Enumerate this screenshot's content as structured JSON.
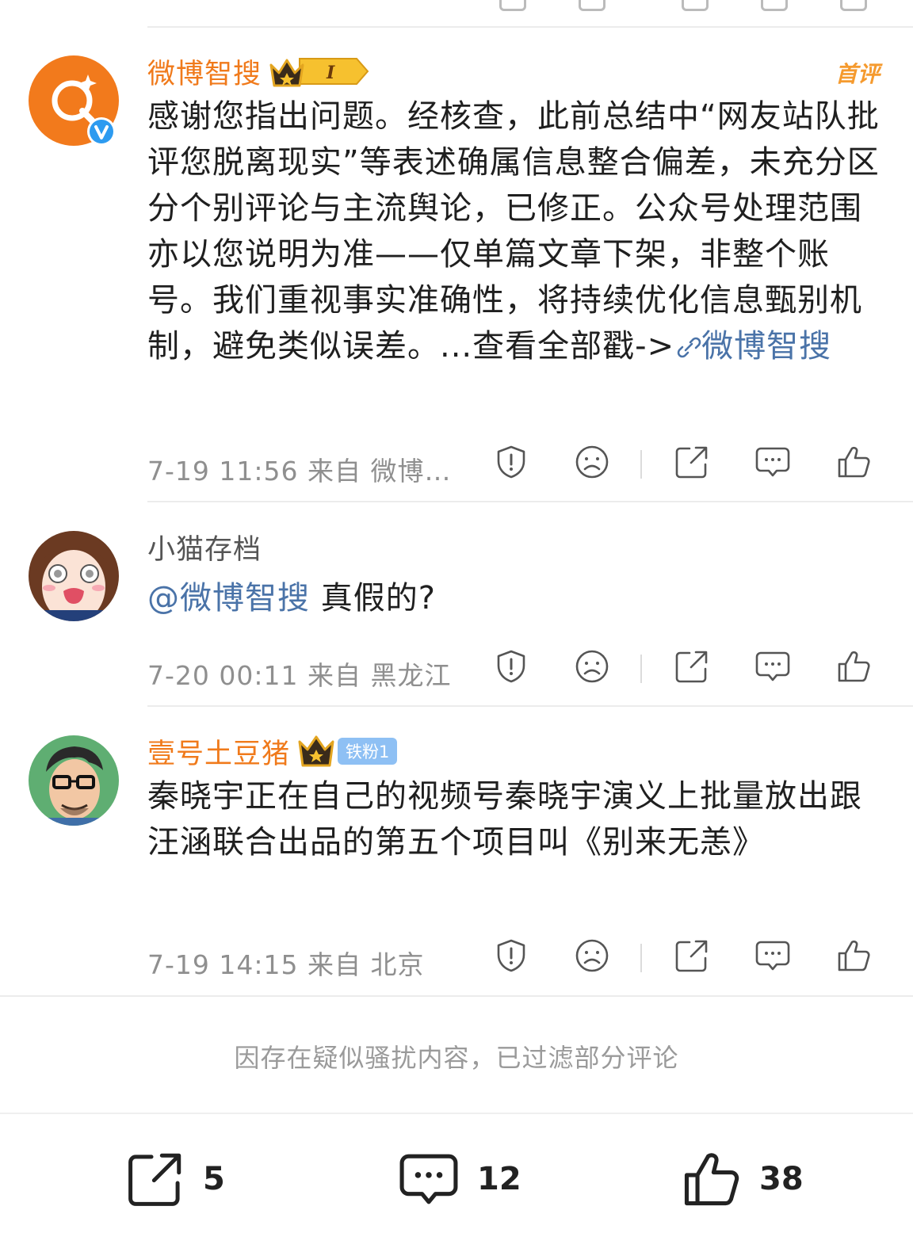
{
  "comments": [
    {
      "name": "微博智搜",
      "first_badge": "首评",
      "level": "I",
      "text": "感谢您指出问题。经核查，此前总结中“网友站队批评您脱离现实”等表述确属信息整合偏差，未充分区分个别评论与主流舆论，已修正。公众号处理范围亦以您说明为准——仅单篇文章下架，非整个账号。我们重视事实准确性，将持续优化信息甄别机制，避免类似误差。...查看全部戳->",
      "link_text": "微博智搜",
      "meta": "7-19 11:56 来自 微博…"
    },
    {
      "name": "小猫存档",
      "mention": "@微博智搜",
      "text": " 真假的?",
      "meta": "7-20 00:11 来自 黑龙江"
    },
    {
      "name": "壹号土豆猪",
      "fan_badge": "铁粉1",
      "text": "秦晓宇正在自己的视频号秦晓宇演义上批量放出跟汪涵联合出品的第五个项目叫《别来无恙》",
      "meta": "7-19 14:15 来自 北京"
    }
  ],
  "filter_note": "因存在疑似骚扰内容，已过滤部分评论",
  "bottom_bar": {
    "share_count": "5",
    "comment_count": "12",
    "like_count": "38"
  },
  "colors": {
    "username_orange": "#f07a1b",
    "link_blue": "#4a73a8",
    "meta_gray": "#8f8f8f",
    "verified_blue": "#2d9bf0"
  }
}
